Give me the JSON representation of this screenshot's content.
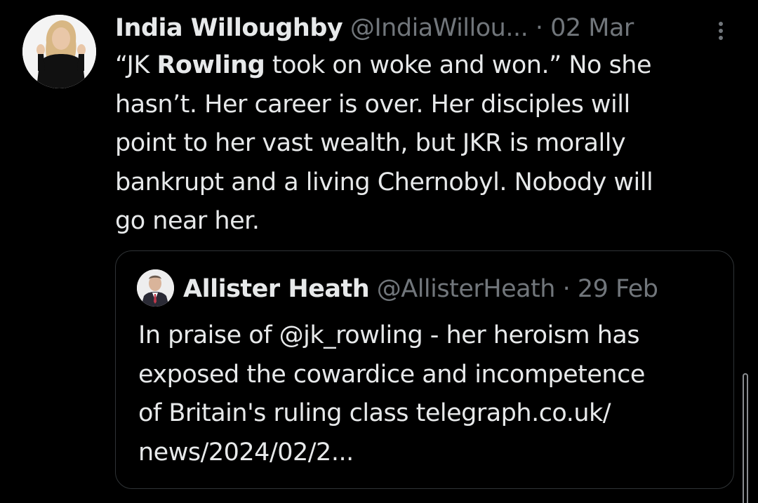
{
  "post": {
    "author_name": "India Willoughby",
    "author_handle": "@IndiaWillou...",
    "date": "· 02 Mar",
    "text_prefix": "“JK ",
    "text_bold": "Rowling",
    "text_rest": " took on woke and won.” No she\nhasn’t. Her career is over. Her disciples will\npoint to her vast wealth, but JKR is morally\nbankrupt and a living Chernobyl. Nobody will\ngo near her.",
    "more_icon": "more-vertical-icon"
  },
  "quote": {
    "author_name": "Allister Heath",
    "author_handle": "@AllisterHeath",
    "date": "· 29 Feb",
    "text": "In praise of @jk_rowling - her heroism has\nexposed the cowardice and incompetence\nof Britain's ruling class telegraph.co.uk/\nnews/2024/02/2..."
  },
  "colors": {
    "background": "#000000",
    "primary_text": "#e7e9ea",
    "secondary_text": "#71767b",
    "card_border": "#2f3336"
  }
}
